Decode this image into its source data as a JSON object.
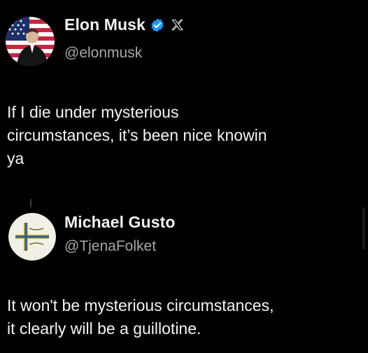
{
  "colors": {
    "background": "#000000",
    "text_primary": "#f4f4f4",
    "text_secondary": "#a8a8a8",
    "verified_blue": "#1d9bf0"
  },
  "tweet": {
    "author": {
      "display_name": "Elon Musk",
      "handle": "@elonmusk",
      "avatar_icon": "flag-portrait-avatar",
      "verified_icon": "verified-badge-icon",
      "platform_icon": "x-logo-icon"
    },
    "text": "If I die under mysterious\ncircumstances, it’s been nice knowin\nya"
  },
  "reply": {
    "author": {
      "display_name": "Michael Gusto",
      "handle": "@TjenaFolket",
      "avatar_icon": "cross-emblem-avatar"
    },
    "text": "It won't be mysterious circumstances,\nit clearly will be a guillotine."
  }
}
